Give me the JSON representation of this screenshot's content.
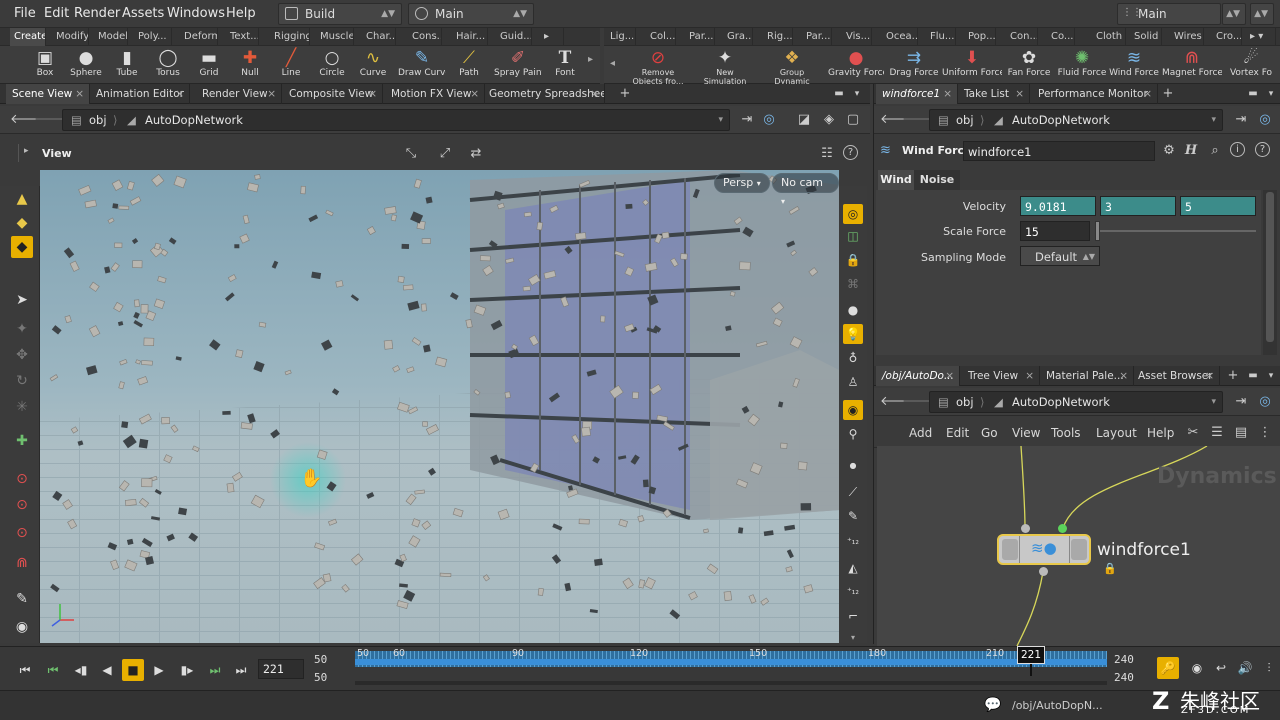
{
  "menu": [
    "File",
    "Edit",
    "Render",
    "Assets",
    "Windows",
    "Help"
  ],
  "desktop": {
    "left": "Build",
    "center": "Main",
    "right": "Main"
  },
  "shelf_tabs_left": [
    "Create",
    "Modify",
    "Model",
    "Poly...",
    "Deform",
    "Text...",
    "Rigging",
    "Muscles",
    "Char...",
    "Cons...",
    "Hair...",
    "Guid..."
  ],
  "shelf_tabs_right": [
    "Lig...",
    "Col...",
    "Par...",
    "Gra...",
    "Rig...",
    "Par...",
    "Vis...",
    "Ocea...",
    "Flu...",
    "Pop...",
    "Con...",
    "Co...",
    "Cloth",
    "Solid",
    "Wires",
    "Cro..."
  ],
  "tools_left": [
    {
      "label": "Box",
      "icon": "box-icon"
    },
    {
      "label": "Sphere",
      "icon": "sphere-icon"
    },
    {
      "label": "Tube",
      "icon": "tube-icon"
    },
    {
      "label": "Torus",
      "icon": "torus-icon"
    },
    {
      "label": "Grid",
      "icon": "grid-icon"
    },
    {
      "label": "Null",
      "icon": "null-icon"
    },
    {
      "label": "Line",
      "icon": "line-icon"
    },
    {
      "label": "Circle",
      "icon": "circle-icon"
    },
    {
      "label": "Curve",
      "icon": "curve-icon"
    },
    {
      "label": "Draw Curve",
      "icon": "draw-curve-icon"
    },
    {
      "label": "Path",
      "icon": "path-icon"
    },
    {
      "label": "Spray Paint",
      "icon": "spray-paint-icon"
    },
    {
      "label": "Font",
      "icon": "font-icon"
    }
  ],
  "tools_right": [
    {
      "label": "Remove Objects fro...",
      "icon": "remove-objects-icon"
    },
    {
      "label": "New Simulation",
      "icon": "new-simulation-icon"
    },
    {
      "label": "Group Dynamic Ob...",
      "icon": "group-dynamic-icon"
    },
    {
      "label": "Gravity Force",
      "icon": "gravity-force-icon"
    },
    {
      "label": "Drag Force",
      "icon": "drag-force-icon"
    },
    {
      "label": "Uniform Force",
      "icon": "uniform-force-icon"
    },
    {
      "label": "Fan Force",
      "icon": "fan-force-icon"
    },
    {
      "label": "Fluid Force",
      "icon": "fluid-force-icon"
    },
    {
      "label": "Wind Force",
      "icon": "wind-force-icon"
    },
    {
      "label": "Magnet Force",
      "icon": "magnet-force-icon"
    },
    {
      "label": "Vortex Fo",
      "icon": "vortex-force-icon"
    }
  ],
  "left_tabs": [
    "Scene View",
    "Animation Editor",
    "Render View",
    "Composite View",
    "Motion FX View",
    "Geometry Spreadsheet"
  ],
  "path": {
    "root": "obj",
    "node": "AutoDopNetwork"
  },
  "viewport": {
    "title": "View",
    "persp": "Persp",
    "cam": "No cam"
  },
  "right_top_tabs": [
    "windforce1",
    "Take List",
    "Performance Monitor"
  ],
  "parms": {
    "type": "Wind Force",
    "name": "windforce1",
    "tabs": [
      "Wind",
      "Noise"
    ],
    "velocity_label": "Velocity",
    "velocity": [
      "9.0181",
      "3",
      "5"
    ],
    "scale_label": "Scale Force",
    "scale": "15",
    "sampling_label": "Sampling Mode",
    "sampling": "Default"
  },
  "right_bottom_tabs": [
    "/obj/AutoDo...",
    "Tree View",
    "Material Pale...",
    "Asset Browser"
  ],
  "net_menu": [
    "Add",
    "Edit",
    "Go",
    "View",
    "Tools",
    "Layout",
    "Help"
  ],
  "net": {
    "context": "Dynamics",
    "node": "windforce1"
  },
  "timeline": {
    "frame": "221",
    "start": "50",
    "start2": "50",
    "end": "240",
    "end2": "240",
    "cursor": "221",
    "ticks": [
      "50",
      "60",
      "90",
      "120",
      "150",
      "180",
      "210"
    ]
  },
  "status": {
    "path": "/obj/AutoDopN...",
    "watermark": "朱峰社区",
    "watermark_url": "ZF3D.COM"
  }
}
